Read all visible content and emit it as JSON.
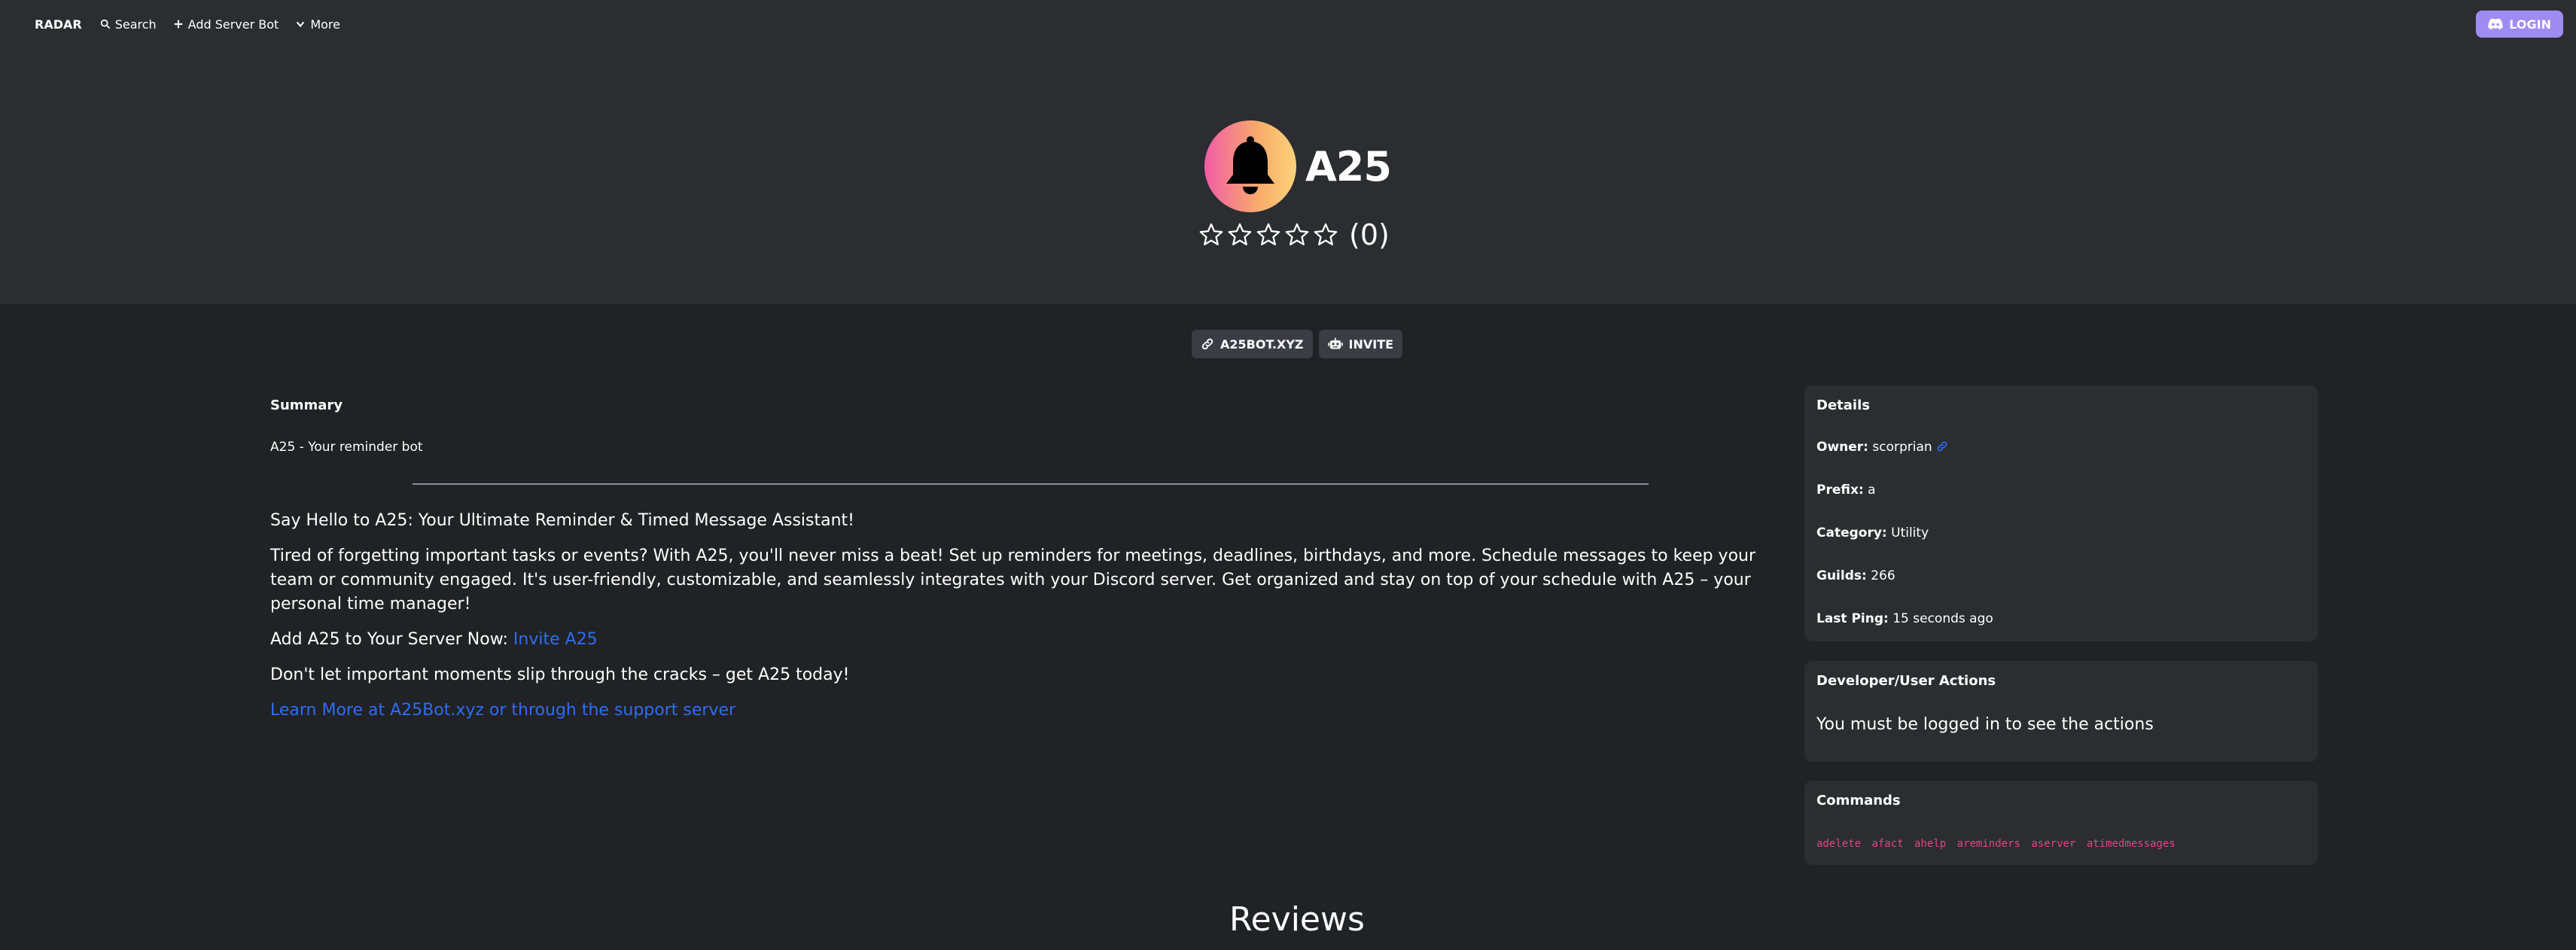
{
  "nav": {
    "brand": "RADAR",
    "search": "Search",
    "add_server_bot": "Add Server Bot",
    "more": "More",
    "login": "LOGIN"
  },
  "bot": {
    "name": "A25",
    "rating_count": "(0)",
    "rating_value": 0,
    "rating_max": 5,
    "avatar_colors": [
      "#f25ca6",
      "#f8ad6a",
      "#fbd27a"
    ]
  },
  "buttons": {
    "website": "A25BOT.XYZ",
    "invite": "INVITE"
  },
  "summary": {
    "title": "Summary",
    "text": "A25 - Your reminder bot"
  },
  "description": {
    "heading": "Say Hello to A25: Your Ultimate Reminder & Timed Message Assistant!",
    "paragraph": "Tired of forgetting important tasks or events? With A25, you'll never miss a beat! Set up reminders for meetings, deadlines, birthdays, and more. Schedule messages to keep your team or community engaged. It's user-friendly, customizable, and seamlessly integrates with your Discord server. Get organized and stay on top of your schedule with A25 – your personal time manager!",
    "add_prefix": "Add A25 to Your Server Now: ",
    "add_link": "Invite A25",
    "dont_let": "Don't let important moments slip through the cracks – get A25 today!",
    "learn_more": "Learn More at A25Bot.xyz or through the support server"
  },
  "details": {
    "title": "Details",
    "owner_label": "Owner:",
    "owner_value": "scorprian",
    "prefix_label": "Prefix:",
    "prefix_value": "a",
    "category_label": "Category:",
    "category_value": "Utility",
    "guilds_label": "Guilds:",
    "guilds_value": "266",
    "last_ping_label": "Last Ping:",
    "last_ping_value": "15 seconds ago"
  },
  "dev_actions": {
    "title": "Developer/User Actions",
    "message": "You must be logged in to see the actions"
  },
  "commands": {
    "title": "Commands",
    "list": [
      "adelete",
      "afact",
      "ahelp",
      "areminders",
      "aserver",
      "atimedmessages"
    ]
  },
  "reviews": {
    "title": "Reviews"
  },
  "colors": {
    "background": "#202225",
    "hero": "#2b2d31",
    "login_button": "#9f8cf3",
    "link": "#2e6df2",
    "command": "#e2467f"
  }
}
